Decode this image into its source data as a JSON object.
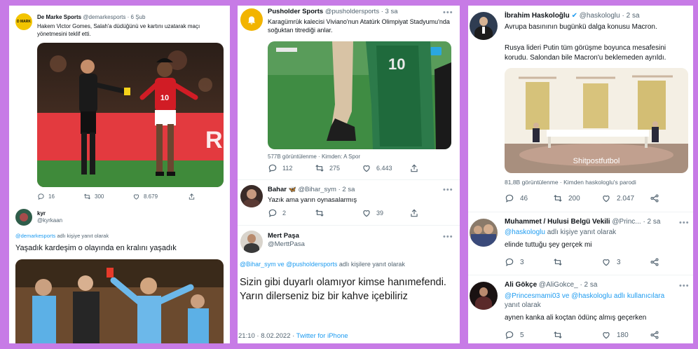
{
  "panel1": {
    "tweet1": {
      "avatar_text": "D MARK",
      "name": "De Marke Sports",
      "handle": "@demarkesports",
      "time": "· 6 Şub",
      "text": "Hakem Victor Gomes, Salah'a düdüğünü ve kartını uzatarak maçı yönetmesini teklif etti.",
      "jersey_number": "10",
      "banner_text": "RUT",
      "actions": {
        "replies": "16",
        "retweets": "300",
        "likes": "8.679"
      }
    },
    "tweet2": {
      "name": "kyr",
      "handle": "@kyrkaan",
      "reply_prefix": "@demarkesports",
      "reply_suffix": "adlı kişiye yanıt olarak",
      "text": "Yaşadık kardeşim o olayında en kralını yaşadık"
    }
  },
  "panel2": {
    "tweet1": {
      "name": "Pusholder Sports",
      "handle": "@pusholdersports",
      "time": "· 3 sa",
      "text": "Karagümrük kalecisi Viviano'nun Atatürk Olimpiyat Stadyumu'nda soğuktan titrediği anlar.",
      "jersey_number": "10",
      "views": "577B görüntülenme · Kimden: A Spor",
      "actions": {
        "replies": "112",
        "retweets": "275",
        "likes": "6.443"
      }
    },
    "tweet2": {
      "name": "Bahar",
      "handle": "@Bihar_sym",
      "time": "· 2 sa",
      "text": "Yazık ama yarın oynasalarmış",
      "actions": {
        "replies": "2",
        "retweets": "",
        "likes": "39"
      }
    },
    "tweet3": {
      "name": "Mert Paşa",
      "handle": "@MerttPasa",
      "reply_prefix": "@Bihar_sym ve @pusholdersports",
      "reply_suffix": "adlı kişilere yanıt olarak",
      "text": "Sizin gibi duyarlı olamıyor kimse hanımefendi. Yarın dilerseniz biz bir kahve içebiliriz",
      "timestamp": "21:10 · 8.02.2022 ·",
      "source": "Twitter for iPhone"
    }
  },
  "panel3": {
    "tweet1": {
      "name": "İbrahim Haskoloğlu",
      "handle": "@haskologlu",
      "time": "· 2 sa",
      "text1": "Avrupa basınının bugünkü dalga konusu Macron.",
      "text2": "Rusya lideri Putin tüm görüşme boyunca mesafesini korudu. Salondan bile Macron'u beklemeden ayrıldı.",
      "watermark": "Shitpostfutbol",
      "views": "81,8B görüntülenme · Kimden haskologlu's parodi",
      "actions": {
        "replies": "46",
        "retweets": "200",
        "likes": "2.047"
      }
    },
    "tweet2": {
      "name": "Muhammet / Hulusi Belgü Vekili",
      "handle": "@Princ...",
      "time": "· 2 sa",
      "reply_prefix": "@haskologlu",
      "reply_suffix": "adlı kişiye yanıt olarak",
      "text": "elinde tuttuğu şey gerçek mi",
      "actions": {
        "replies": "3",
        "retweets": "",
        "likes": "3"
      }
    },
    "tweet3": {
      "name": "Ali Gökçe",
      "handle": "@AliGokce_",
      "time": "· 2 sa",
      "reply_prefix": "@Princesmami03 ve @haskologlu adlı kullanıcılara",
      "reply_suffix": "yanıt olarak",
      "text": "aynen kanka ali koçtan ödünç almış geçerken",
      "actions": {
        "replies": "5",
        "retweets": "",
        "likes": "180"
      }
    }
  },
  "colors": {
    "background": "#c77be6",
    "link": "#1d9bf0",
    "muted": "#536471",
    "text": "#0f1419"
  },
  "icons": [
    "reply-icon",
    "retweet-icon",
    "like-icon",
    "share-icon",
    "more-icon"
  ]
}
